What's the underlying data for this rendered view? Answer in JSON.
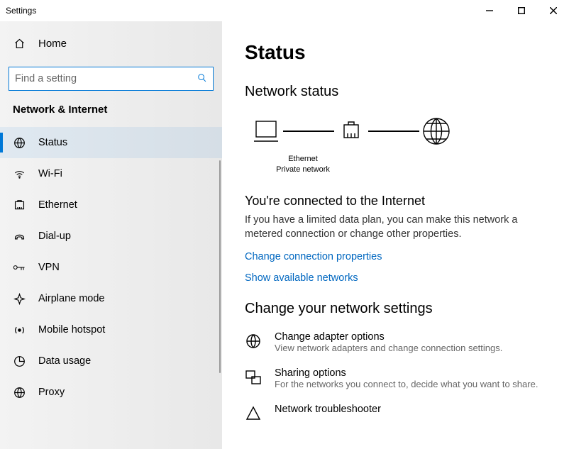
{
  "window": {
    "title": "Settings"
  },
  "sidebar": {
    "home": "Home",
    "search_placeholder": "Find a setting",
    "section": "Network & Internet",
    "items": [
      {
        "label": "Status",
        "icon": "status-icon",
        "active": true
      },
      {
        "label": "Wi-Fi",
        "icon": "wifi-icon",
        "active": false
      },
      {
        "label": "Ethernet",
        "icon": "ethernet-icon",
        "active": false
      },
      {
        "label": "Dial-up",
        "icon": "dialup-icon",
        "active": false
      },
      {
        "label": "VPN",
        "icon": "vpn-icon",
        "active": false
      },
      {
        "label": "Airplane mode",
        "icon": "airplane-icon",
        "active": false
      },
      {
        "label": "Mobile hotspot",
        "icon": "hotspot-icon",
        "active": false
      },
      {
        "label": "Data usage",
        "icon": "data-usage-icon",
        "active": false
      },
      {
        "label": "Proxy",
        "icon": "proxy-icon",
        "active": false
      }
    ]
  },
  "main": {
    "page_title": "Status",
    "network_status_heading": "Network status",
    "diagram_connection_name": "Ethernet",
    "diagram_connection_type": "Private network",
    "connected_heading": "You're connected to the Internet",
    "connected_body": "If you have a limited data plan, you can make this network a metered connection or change other properties.",
    "link_change_props": "Change connection properties",
    "link_show_networks": "Show available networks",
    "change_settings_heading": "Change your network settings",
    "options": [
      {
        "title": "Change adapter options",
        "sub": "View network adapters and change connection settings.",
        "icon": "adapter-icon"
      },
      {
        "title": "Sharing options",
        "sub": "For the networks you connect to, decide what you want to share.",
        "icon": "sharing-icon"
      },
      {
        "title": "Network troubleshooter",
        "sub": "",
        "icon": "troubleshoot-icon"
      }
    ]
  }
}
